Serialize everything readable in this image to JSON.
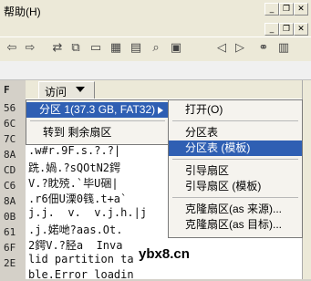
{
  "menubar": {
    "help_label": "帮助(H)"
  },
  "window_buttons": {
    "minimize": "_",
    "restore": "❐",
    "close": "✕"
  },
  "header": {
    "col_label": "F",
    "visit_button": "访问"
  },
  "left_hex": [
    "56",
    "6C",
    "7C",
    "8A",
    "CD",
    "C6",
    "8A",
    "0B",
    "61",
    "6F",
    "2E"
  ],
  "text_lines": [
    ".w#r.9F.s.?.?|",
    "跣.媧.?sQOtN2鍔",
    "V.?眈殑.`毕U硱|",
    ".r6佃U溧0篯.t+a`",
    "j.j.  v.  v.j.h.|j",
    ".j.婼哋?aas.Ot.",
    "2鍔V.?胫a  Inva",
    "lid partition ta",
    "ble.Error loadin"
  ],
  "menu1": {
    "items": [
      "分区 1(37.3 GB, FAT32)",
      "转到 剩余扇区"
    ]
  },
  "submenu": {
    "items": [
      "打开(O)",
      "分区表",
      "分区表 (模板)",
      "引导扇区",
      "引导扇区 (模板)",
      "克隆扇区(as 来源)...",
      "克隆扇区(as 目标)..."
    ]
  },
  "watermark": "ybx8.cn",
  "colors": {
    "selection": "#2f5fb3"
  }
}
